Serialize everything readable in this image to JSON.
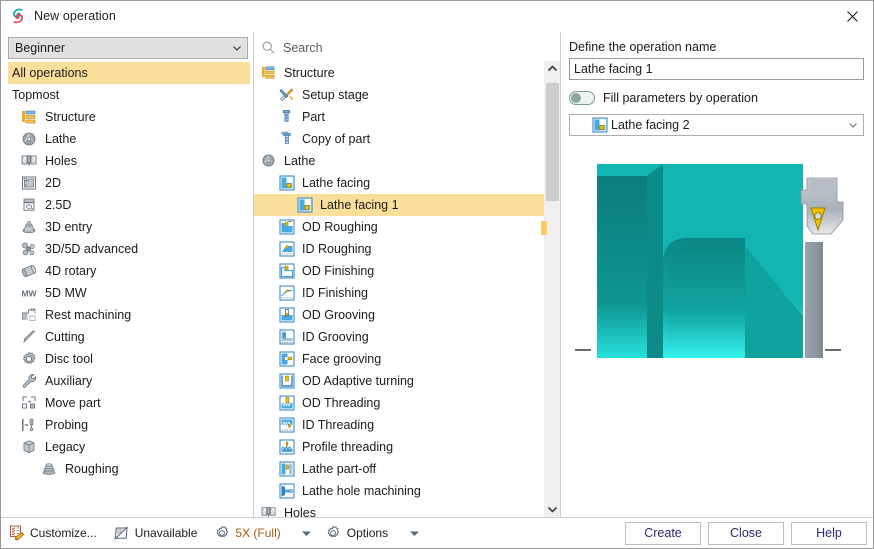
{
  "window": {
    "title": "New operation",
    "logo_icon": "sprut-logo-icon",
    "close_icon": "close-icon"
  },
  "left_panel": {
    "level_combo": {
      "value": "Beginner",
      "chevron_icon": "chevron-down-icon"
    },
    "items": [
      {
        "label": "All operations",
        "icon": "",
        "indent": 0,
        "selected": true
      },
      {
        "label": "Topmost",
        "icon": "",
        "indent": 0,
        "selected": false
      },
      {
        "label": "Structure",
        "icon": "structure-icon",
        "indent": 1,
        "selected": false
      },
      {
        "label": "Lathe",
        "icon": "lathe-icon",
        "indent": 1,
        "selected": false
      },
      {
        "label": "Holes",
        "icon": "holes-icon",
        "indent": 1,
        "selected": false
      },
      {
        "label": "2D",
        "icon": "twod-icon",
        "indent": 1,
        "selected": false
      },
      {
        "label": "2.5D",
        "icon": "twofived-icon",
        "indent": 1,
        "selected": false
      },
      {
        "label": "3D entry",
        "icon": "threed-entry-icon",
        "indent": 1,
        "selected": false
      },
      {
        "label": "3D/5D advanced",
        "icon": "threed-fived-advanced-icon",
        "indent": 1,
        "selected": false
      },
      {
        "label": "4D rotary",
        "icon": "fourd-rotary-icon",
        "indent": 1,
        "selected": false
      },
      {
        "label": "5D MW",
        "icon": "fived-mw-icon",
        "indent": 1,
        "selected": false
      },
      {
        "label": "Rest machining",
        "icon": "rest-machining-icon",
        "indent": 1,
        "selected": false
      },
      {
        "label": "Cutting",
        "icon": "cutting-icon",
        "indent": 1,
        "selected": false
      },
      {
        "label": "Disc tool",
        "icon": "disc-tool-icon",
        "indent": 1,
        "selected": false
      },
      {
        "label": "Auxiliary",
        "icon": "auxiliary-wrench-icon",
        "indent": 1,
        "selected": false
      },
      {
        "label": "Move part",
        "icon": "move-part-icon",
        "indent": 1,
        "selected": false
      },
      {
        "label": "Probing",
        "icon": "probing-icon",
        "indent": 1,
        "selected": false
      },
      {
        "label": "Legacy",
        "icon": "legacy-icon",
        "indent": 1,
        "selected": false
      },
      {
        "label": "Roughing",
        "icon": "roughing-icon",
        "indent": 2,
        "selected": false
      }
    ]
  },
  "middle_panel": {
    "search": {
      "placeholder": "Search",
      "value": "",
      "icon": "search-icon"
    },
    "tree": [
      {
        "label": "Structure",
        "icon": "structure-icon",
        "depth": 0,
        "selected": false
      },
      {
        "label": "Setup stage",
        "icon": "setup-stage-icon",
        "depth": 1,
        "selected": false
      },
      {
        "label": "Part",
        "icon": "part-icon",
        "depth": 1,
        "selected": false
      },
      {
        "label": "Copy of part",
        "icon": "copy-of-part-icon",
        "depth": 1,
        "selected": false
      },
      {
        "label": "Lathe",
        "icon": "lathe-icon",
        "depth": 0,
        "selected": false
      },
      {
        "label": "Lathe facing",
        "icon": "lathe-facing-icon",
        "depth": 1,
        "selected": false
      },
      {
        "label": "Lathe facing 1",
        "icon": "lathe-facing-icon",
        "depth": 2,
        "selected": true
      },
      {
        "label": "OD Roughing",
        "icon": "od-roughing-icon",
        "depth": 1,
        "selected": false
      },
      {
        "label": "ID Roughing",
        "icon": "id-roughing-icon",
        "depth": 1,
        "selected": false
      },
      {
        "label": "OD Finishing",
        "icon": "od-finishing-icon",
        "depth": 1,
        "selected": false
      },
      {
        "label": "ID Finishing",
        "icon": "id-finishing-icon",
        "depth": 1,
        "selected": false
      },
      {
        "label": "OD Grooving",
        "icon": "od-grooving-icon",
        "depth": 1,
        "selected": false
      },
      {
        "label": "ID Grooving",
        "icon": "id-grooving-icon",
        "depth": 1,
        "selected": false
      },
      {
        "label": "Face grooving",
        "icon": "face-grooving-icon",
        "depth": 1,
        "selected": false
      },
      {
        "label": "OD Adaptive turning",
        "icon": "od-adaptive-turning-icon",
        "depth": 1,
        "selected": false
      },
      {
        "label": "OD Threading",
        "icon": "od-threading-icon",
        "depth": 1,
        "selected": false
      },
      {
        "label": "ID Threading",
        "icon": "id-threading-icon",
        "depth": 1,
        "selected": false
      },
      {
        "label": "Profile threading",
        "icon": "profile-threading-icon",
        "depth": 1,
        "selected": false
      },
      {
        "label": "Lathe part-off",
        "icon": "lathe-part-off-icon",
        "depth": 1,
        "selected": false
      },
      {
        "label": "Lathe hole machining",
        "icon": "lathe-hole-machining-icon",
        "depth": 1,
        "selected": false
      },
      {
        "label": "Holes",
        "icon": "holes-icon",
        "depth": 0,
        "selected": false
      }
    ],
    "scrollbar": {
      "up_icon": "chevron-up-icon",
      "down_icon": "chevron-down-icon"
    }
  },
  "right_panel": {
    "name_label": "Define the operation name",
    "name_value": "Lathe facing 1",
    "fill_toggle": {
      "label": "Fill parameters by operation",
      "state": "off"
    },
    "operation_combo": {
      "value": "Lathe facing 2",
      "icon": "lathe-facing-icon",
      "chevron_icon": "chevron-down-icon"
    }
  },
  "footer": {
    "customize": {
      "label": "Customize...",
      "icon": "customize-icon"
    },
    "unavailable": {
      "label": "Unavailable",
      "icon": "unavailable-icon"
    },
    "axis_mode": {
      "label": "5X (Full)",
      "icon": "gear-icon"
    },
    "axis_dropdown_icon": "caret-down-icon",
    "options": {
      "label": "Options",
      "icon": "gear-icon"
    },
    "options_dropdown_icon": "caret-down-icon",
    "buttons": [
      {
        "label": "Create",
        "name": "create-button"
      },
      {
        "label": "Close",
        "name": "close-button"
      },
      {
        "label": "Help",
        "name": "help-button"
      }
    ]
  },
  "colors": {
    "selection": "#fadf9a",
    "teal_part": "#12b4b0",
    "teal_dark": "#0c8a88",
    "tool_holder": "#8c949c",
    "insert_yellow": "#f2c200",
    "orange_text": "#a85b13"
  }
}
